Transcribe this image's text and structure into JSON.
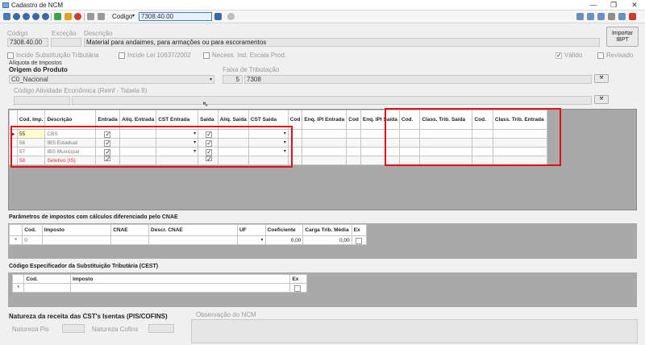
{
  "window": {
    "title": "Cadastro de NCM"
  },
  "toolbar": {
    "codigo_label": "Codigo",
    "codigo_value": "7308.40.00"
  },
  "header": {
    "codigo_label": "Código",
    "excecao_label": "Exceção",
    "descricao_label": "Descrição",
    "codigo_value": "7308.40.00",
    "descricao_value": "Material para andaimes, para armações ou para escoramentos",
    "importar_btn_line1": "Importar",
    "importar_btn_line2": "IBPT"
  },
  "flags": {
    "incide_st": "Incide Substituição Tributária",
    "incide_lei": "Incide Lei 10637/2002",
    "necess": "Necess. Ind. Escala Prod.",
    "valido": "Válido",
    "revisado": "Revisado"
  },
  "impostos": {
    "section": "Alíquota de Impostos",
    "origem_label": "Origem do Produto",
    "origem_value": "C0_Nacional",
    "faixa_label": "Faixa de Tributação",
    "faixa_num": "5",
    "faixa_value": "7308",
    "atividade_label": "Código Atividade Econômica (Reinf - Tabela 9)"
  },
  "main_grid": {
    "headers": [
      "Cod. Imp.",
      "Descrição",
      "Entrada",
      "Alíq. Entrada",
      "CST Entrada",
      "Saida",
      "Alíq. Saída",
      "CST Saida",
      "Cod",
      "Enq. IPI Entrada",
      "Cod",
      "Enq. IPI Saída",
      "Cod.",
      "Class. Trib. Saída",
      "Cod.",
      "Class. Trib. Entrada"
    ],
    "rows": [
      {
        "cod": "55",
        "desc": "CBS"
      },
      {
        "cod": "56",
        "desc": "IBS Estadual"
      },
      {
        "cod": "57",
        "desc": "IBS Municipal"
      },
      {
        "cod": "58",
        "desc": "Seletivo (IS)"
      }
    ]
  },
  "cnae": {
    "title": "Parâmetros de impostos com cálculos diferenciado pelo CNAE",
    "headers": [
      "Cod.",
      "Imposto",
      "CNAE",
      "Descr. CNAE",
      "UF",
      "Coeficiente",
      "Carga Trib. Média",
      "Ex"
    ],
    "row": {
      "cod": "0",
      "coef": "0,00",
      "carga": "0,00"
    }
  },
  "cest": {
    "title": "Código Especificador da Substituição Tributária (CEST)",
    "headers": [
      "Cod.",
      "Imposto",
      "Ex"
    ]
  },
  "footer": {
    "natureza_label": "Natureza da receita das CST's Isentas (PIS/COFINS)",
    "pis_label": "Natureza Pis",
    "cofins_label": "Natureza Cofins",
    "obs_label": "Observação do NCM"
  }
}
